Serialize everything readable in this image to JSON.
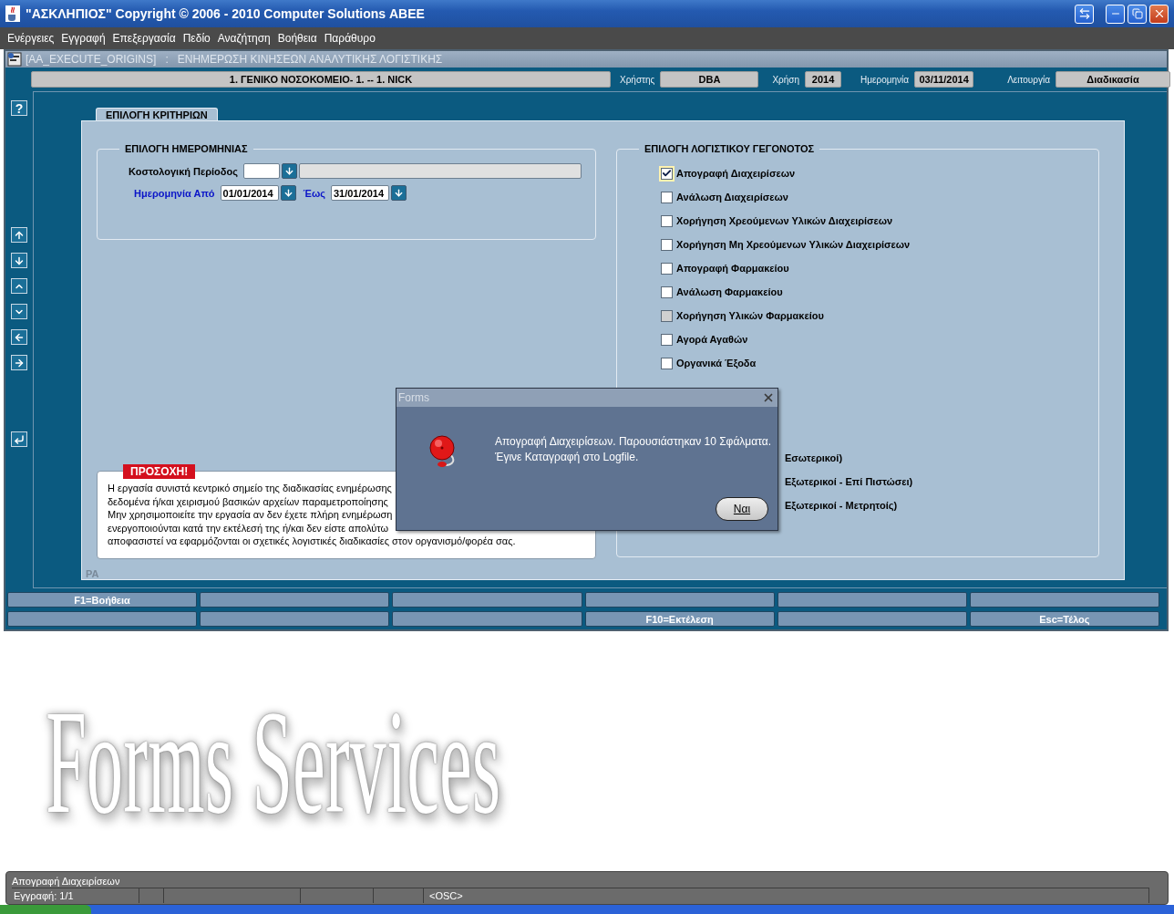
{
  "window": {
    "title": "\"ΑΣΚΛΗΠΙΟΣ\" Copyright © 2006 - 2010 Computer Solutions ΑΒΕΕ"
  },
  "menu": [
    "Ενέργειες",
    "Εγγραφή",
    "Επεξεργασία",
    "Πεδίο",
    "Αναζήτηση",
    "Βοήθεια",
    "Παράθυρο"
  ],
  "form": {
    "title": "[AA_EXECUTE_ORIGINS]   :   ΕΝΗΜΕΡΩΣΗ ΚΙΝΗΣΕΩΝ ΑΝΑΛΥΤΙΚΗΣ ΛΟΓΙΣΤΙΚΗΣ"
  },
  "header": {
    "organization": "1. ΓΕΝΙΚΟ ΝΟΣΟΚΟΜΕΙΟ- 1. -- 1. NICK",
    "fields": [
      {
        "label": "Χρήστης",
        "value": "DBA"
      },
      {
        "label": "Χρήση",
        "value": "2014"
      },
      {
        "label": "Ημερομηνία",
        "value": "03/11/2014"
      },
      {
        "label": "Λειτουργία",
        "value": "Διαδικασία"
      }
    ]
  },
  "help_button": "?",
  "tab": {
    "label": "ΕΠΙΛΟΓΗ ΚΡΙΤΗΡΙΩΝ",
    "selected": true
  },
  "date_group": {
    "title": "ΕΠΙΛΟΓΗ ΗΜΕΡΟΜΗΝΙΑΣ",
    "period_label": "Κοστολογική Περίοδος",
    "from_label": "Ημερομηνία Από",
    "from_value": "01/01/2014",
    "to_label": "Έως",
    "to_value": "31/01/2014"
  },
  "events": {
    "title": "ΕΠΙΛΟΓΗ ΛΟΓΙΣΤΙΚΟΥ ΓΕΓΟΝΟΤΟΣ",
    "items": [
      {
        "kind": "checkbox",
        "label": "Απογραφή Διαχειρίσεων",
        "checked": true,
        "focused": true,
        "disabled": false
      },
      {
        "kind": "checkbox",
        "label": "Ανάλωση Διαχειρίσεων",
        "checked": false,
        "focused": false,
        "disabled": false
      },
      {
        "kind": "checkbox",
        "label": "Χορήγηση Χρεούμενων Υλικών Διαχειρίσεων",
        "checked": false,
        "focused": false,
        "disabled": false
      },
      {
        "kind": "checkbox",
        "label": "Χορήγηση Μη Χρεούμενων Υλικών Διαχειρίσεων",
        "checked": false,
        "focused": false,
        "disabled": false
      },
      {
        "kind": "checkbox",
        "label": "Απογραφή Φαρμακείου",
        "checked": false,
        "focused": false,
        "disabled": false
      },
      {
        "kind": "checkbox",
        "label": "Ανάλωση Φαρμακείου",
        "checked": false,
        "focused": false,
        "disabled": false
      },
      {
        "kind": "checkbox",
        "label": "Χορήγηση Υλικών Φαρμακείου",
        "checked": false,
        "focused": false,
        "disabled": true
      },
      {
        "kind": "checkbox",
        "label": "Αγορά Αγαθών",
        "checked": false,
        "focused": false,
        "disabled": false
      },
      {
        "kind": "checkbox",
        "label": "Οργανικά Έξοδα",
        "checked": false,
        "focused": false,
        "disabled": false
      },
      {
        "kind": "covered",
        "label": "Εσωτερικοί)"
      },
      {
        "kind": "covered",
        "label": "Εξωτερικοί - Επί Πιστώσει)"
      },
      {
        "kind": "covered",
        "label": "Εξωτερικοί - Μετρητοίς)"
      }
    ]
  },
  "warning": {
    "badge": "ΠΡΟΣΟΧΗ!",
    "lines": [
      "Η εργασία συνιστά κεντρικό σημείο της διαδικασίας ενημέρωσης",
      "δεδομένα ή/και χειρισμού βασικών αρχείων παραμετροποίησης",
      "Μην χρησιμοποιείτε την εργασία αν δεν έχετε πλήρη ενημέρωση",
      "ενεργοποιούνται κατά την εκτέλεσή της ή/και δεν είστε απολύτω",
      "αποφασιστεί να εφαρμόζονται οι σχετικές λογιστικές διαδικασίες στον οργανισμό/φορέα σας."
    ]
  },
  "region_label": "PA",
  "function_keys": [
    {
      "kind": "key",
      "label": "F1=Βοήθεια"
    },
    {
      "kind": "blank"
    },
    {
      "kind": "blank"
    },
    {
      "kind": "blank"
    },
    {
      "kind": "blank"
    },
    {
      "kind": "blank"
    },
    {
      "kind": "blank"
    },
    {
      "kind": "blank"
    },
    {
      "kind": "blank"
    },
    {
      "kind": "key",
      "label": "F10=Εκτέλεση"
    },
    {
      "kind": "blank"
    },
    {
      "kind": "key",
      "label": "Esc=Τέλος"
    }
  ],
  "background_logo": "Forms Services",
  "dialog": {
    "title": "Forms",
    "message_lines": [
      "Απογραφή Διαχειρίσεων. Παρουσιάστηκαν 10 Σφάλματα.",
      "Έγινε Καταγραφή στο Logfile."
    ],
    "button": "Ναι"
  },
  "status": {
    "message": "Απογραφή Διαχειρίσεων",
    "cells": [
      {
        "kind": "text",
        "text": "Εγγραφή: 1/1"
      },
      {
        "kind": "blank"
      },
      {
        "kind": "blank"
      },
      {
        "kind": "blank"
      },
      {
        "kind": "blank"
      },
      {
        "kind": "text",
        "text": "<OSC>"
      }
    ]
  }
}
